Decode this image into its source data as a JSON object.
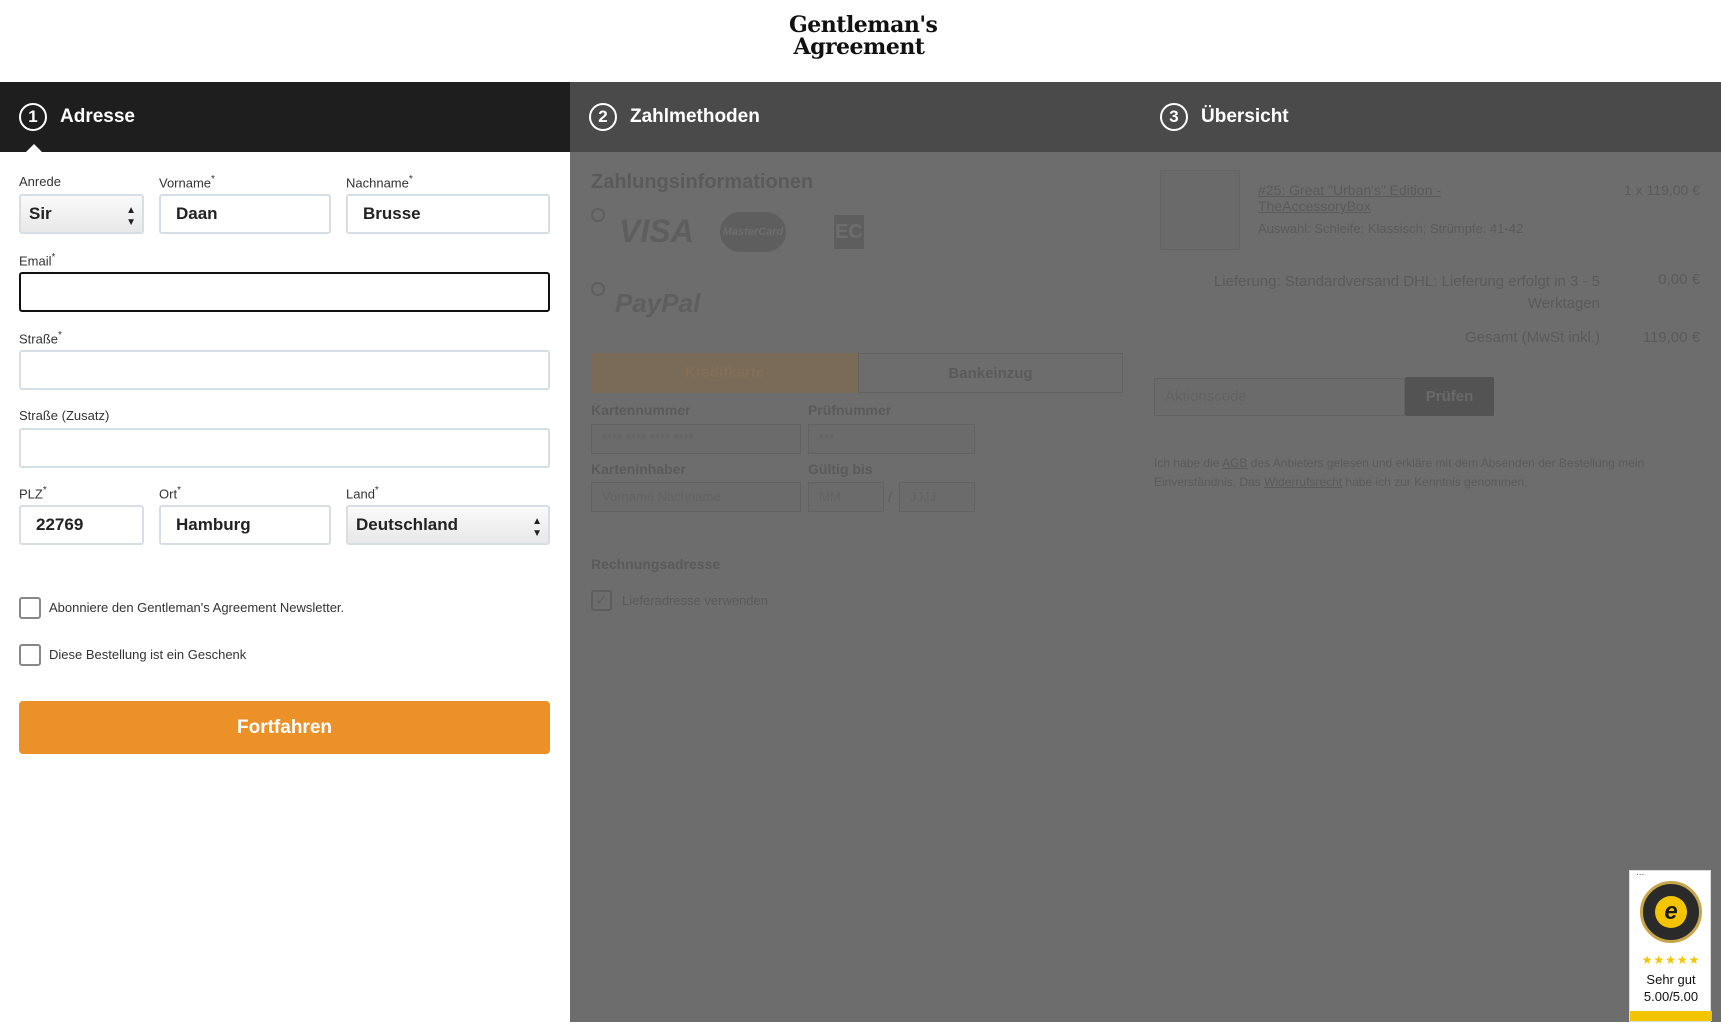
{
  "brand": {
    "line1": "Gentleman's",
    "line2": "Agreement"
  },
  "steps": [
    {
      "num": "1",
      "label": "Adresse"
    },
    {
      "num": "2",
      "label": "Zahlmethoden"
    },
    {
      "num": "3",
      "label": "Übersicht"
    }
  ],
  "address_form": {
    "salutation": {
      "label": "Anrede",
      "value": "Sir"
    },
    "firstname": {
      "label": "Vorname",
      "value": "Daan"
    },
    "lastname": {
      "label": "Nachname",
      "value": "Brusse"
    },
    "email": {
      "label": "Email",
      "value": ""
    },
    "street": {
      "label": "Straße",
      "value": ""
    },
    "street2": {
      "label": "Straße (Zusatz)",
      "value": ""
    },
    "zip": {
      "label": "PLZ",
      "value": "22769"
    },
    "city": {
      "label": "Ort",
      "value": "Hamburg"
    },
    "country": {
      "label": "Land",
      "value": "Deutschland"
    },
    "required_mark": "*",
    "newsletter_label": "Abonniere den Gentleman's Agreement Newsletter.",
    "gift_label": "Diese Bestellung ist ein Geschenk",
    "continue_button": "Fortfahren"
  },
  "payment": {
    "heading": "Zahlungsinformationen",
    "visa": "VISA",
    "mastercard": "MasterCard",
    "ec": "EC",
    "paypal": "PayPal",
    "tabs": [
      "Kreditkarte",
      "Bankeinzug"
    ],
    "card_number_label": "Kartennummer",
    "card_number_placeholder": "**** **** **** ****",
    "cvc_label": "Prüfnummer",
    "cvc_placeholder": "***",
    "holder_label": "Karteninhaber",
    "holder_placeholder": "Vorname Nachname",
    "valid_label": "Gültig bis",
    "mm_placeholder": "MM",
    "slash": "/",
    "yyyy_placeholder": "JJJJ",
    "billing_heading": "Rechnungsadresse",
    "billing_checkbox": "Lieferadresse verwenden"
  },
  "summary": {
    "item_title": "#25: Great \"Urban's\" Edition - TheAccessoryBox",
    "item_options": "Auswahl: Schleife: Klassisch; Strümpfe: 41-42",
    "item_price": "1 x 119,00 €",
    "shipping_label": "Lieferung: Standardversand DHL: Lieferung erfolgt in 3 - 5 Werktagen",
    "shipping_price": "0,00 €",
    "total_label": "Gesamt (MwSt inkl.)",
    "total_price": "119,00 €",
    "promo_placeholder": "Aktionscode",
    "promo_button": "Prüfen",
    "terms_1": "Ich habe die ",
    "terms_agb": "AGB",
    "terms_2": " des Anbieters gelesen und erkläre mit dem Absenden der Bestellung mein Einverständnis. Das ",
    "terms_widerruf": "Widerrufsrecht",
    "terms_3": " habe ich zur Kenntnis genommen."
  },
  "trusted_badge": {
    "dots": "...",
    "stars": "★★★★★",
    "rating_word": "Sehr gut",
    "rating_value": "5.00/5.00"
  },
  "colors": {
    "accent": "#ec9127",
    "step_active": "#1e1e1e",
    "step_inactive": "#4a4a4a",
    "overlay": "#6d6d6d"
  }
}
